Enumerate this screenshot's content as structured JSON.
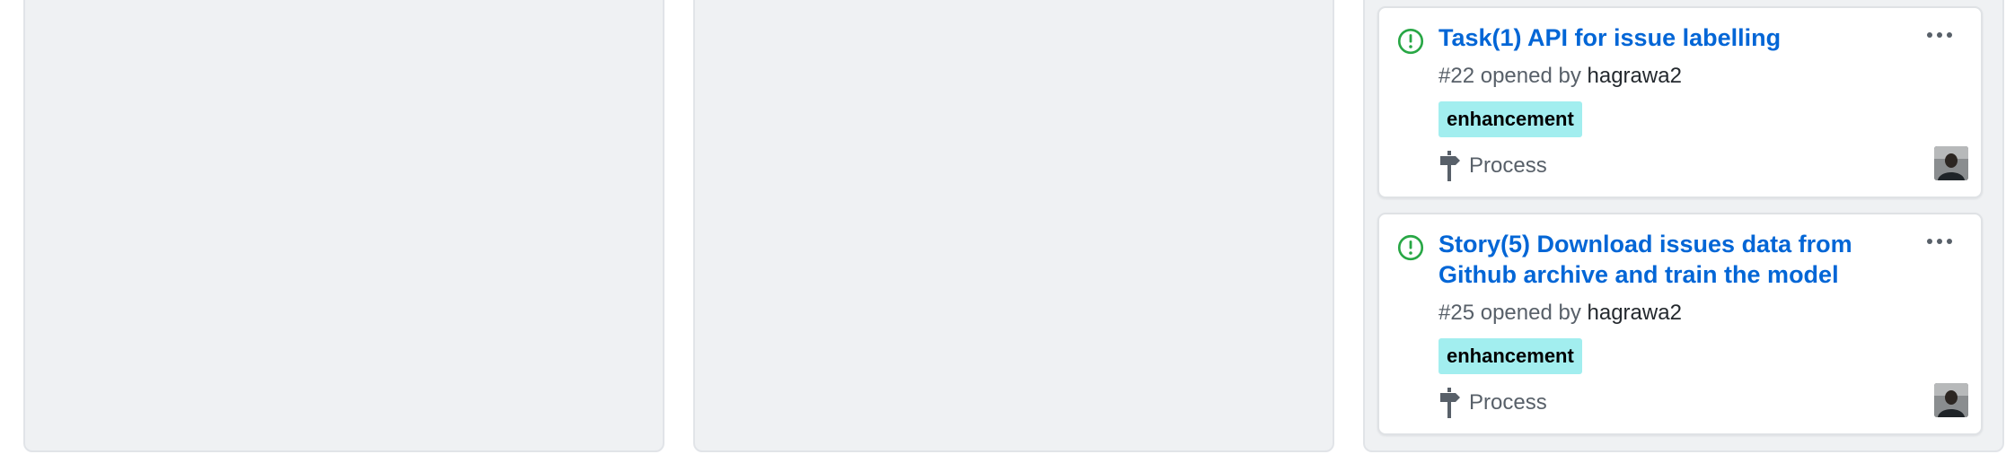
{
  "colors": {
    "link": "#0366d6",
    "open_issue_green": "#28a745",
    "label_enhancement": "#a2eeef",
    "column_bg": "#eff1f3",
    "muted_text": "#586069"
  },
  "columns": [
    {
      "cards": []
    },
    {
      "cards": []
    },
    {
      "cards": [
        {
          "state_icon": "issue-opened-icon",
          "title": "Task(1) API for issue labelling",
          "number": "#22",
          "opened_by_text": "opened by",
          "author": "hagrawa2",
          "label": "enhancement",
          "milestone_icon": "milestone-icon",
          "milestone": "Process",
          "menu_icon": "kebab-horizontal-icon",
          "assignee_avatar": "avatar"
        },
        {
          "state_icon": "issue-opened-icon",
          "title": "Story(5) Download issues data from Github archive and train the model",
          "number": "#25",
          "opened_by_text": "opened by",
          "author": "hagrawa2",
          "label": "enhancement",
          "milestone_icon": "milestone-icon",
          "milestone": "Process",
          "menu_icon": "kebab-horizontal-icon",
          "assignee_avatar": "avatar"
        }
      ]
    }
  ]
}
